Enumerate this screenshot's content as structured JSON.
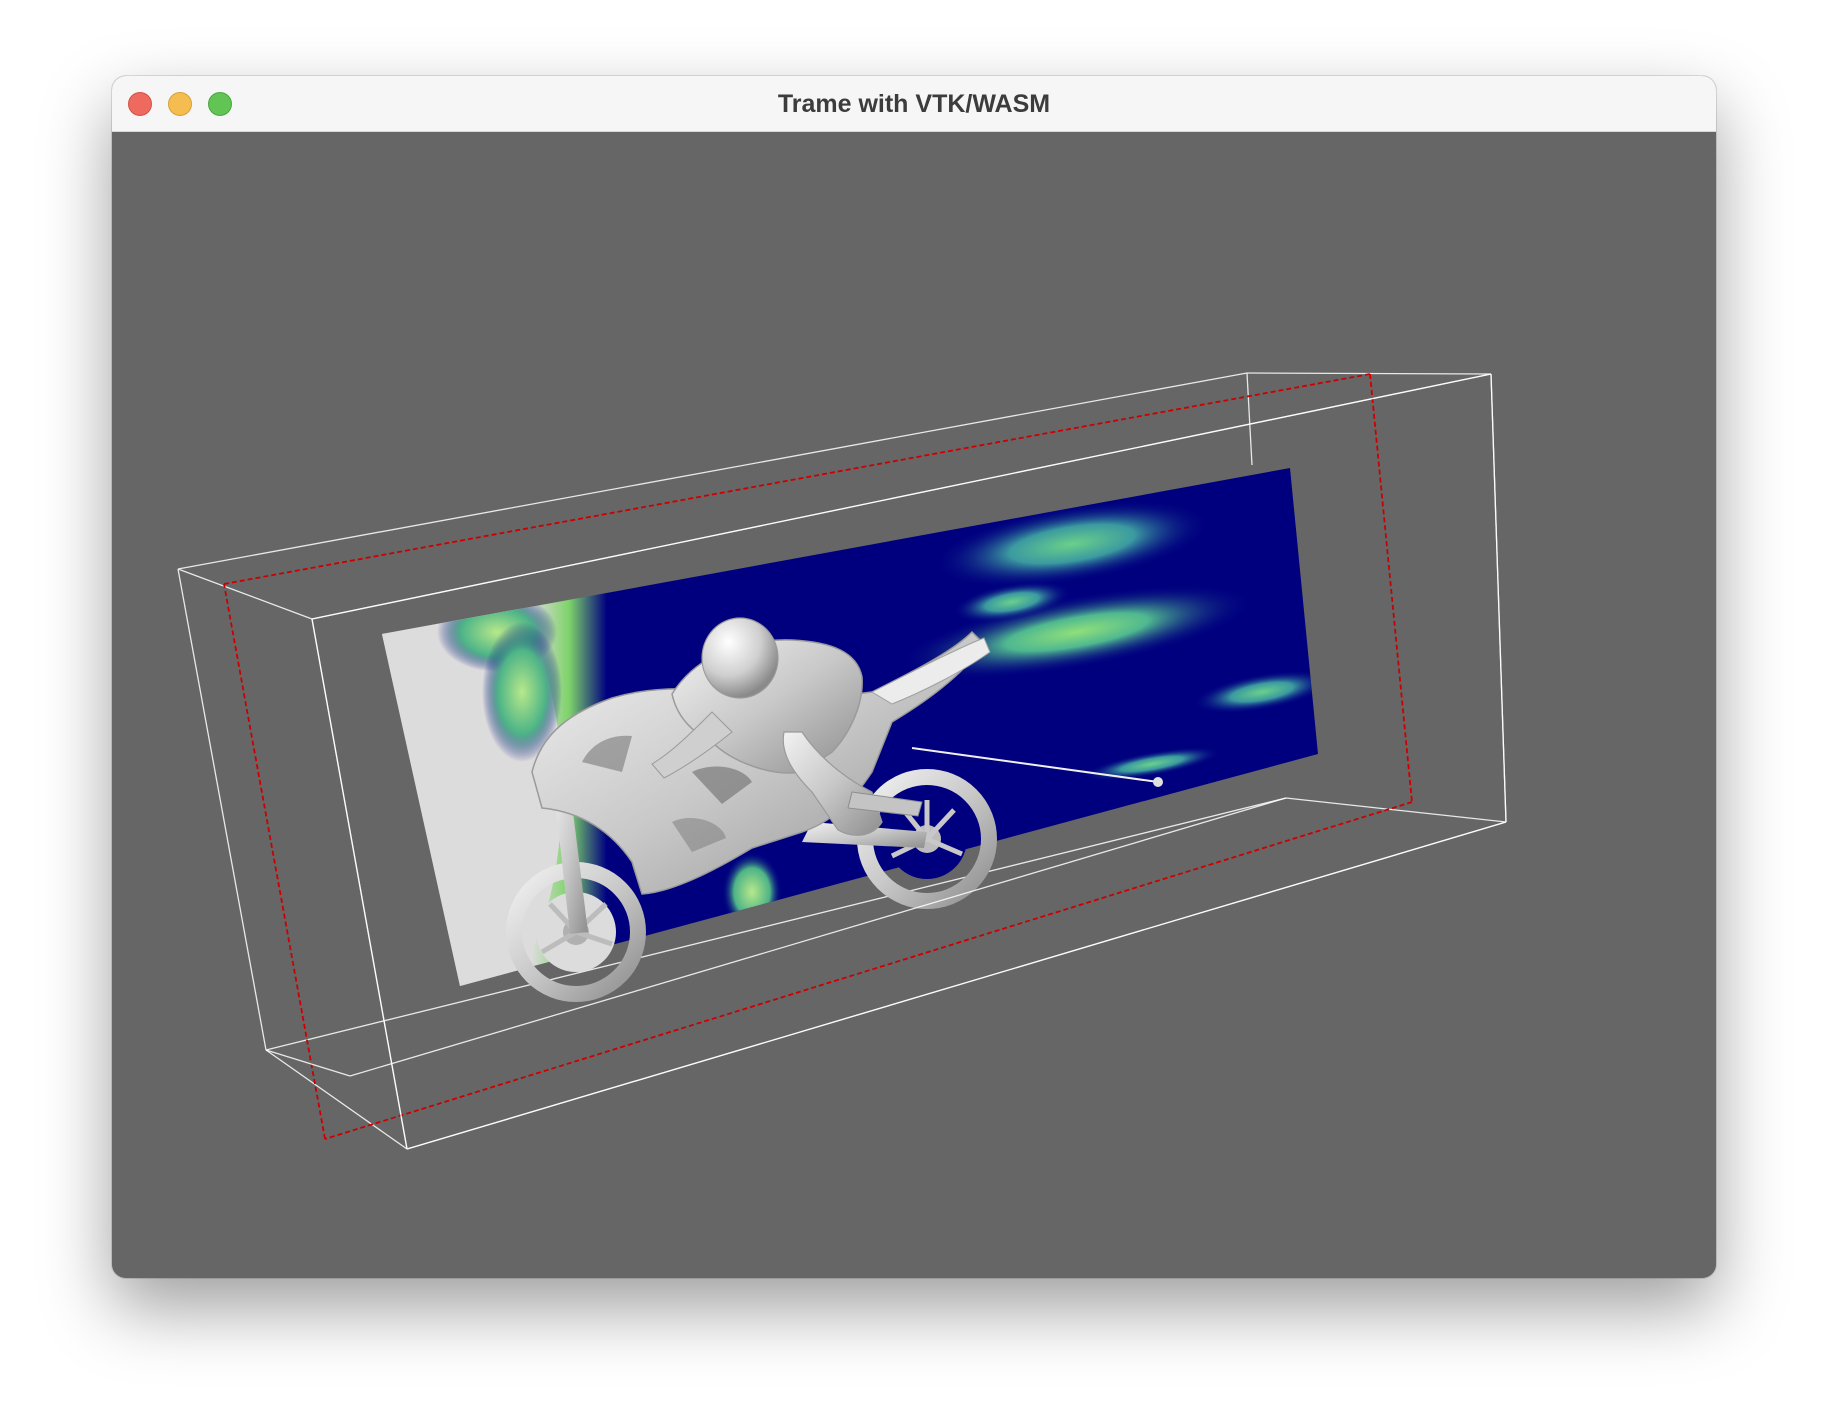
{
  "window": {
    "title": "Trame with VTK/WASM"
  },
  "traffic_lights": {
    "close_icon": "circle-red",
    "minimize_icon": "circle-yellow",
    "zoom_icon": "circle-green"
  },
  "scene": {
    "background_color": "#666666",
    "outline_color": "#ffffff",
    "plane_widget_color": "#cc0000",
    "slice_colormap": [
      "#00007f",
      "#1f5fa0",
      "#4aa6a0",
      "#7ed36a",
      "#dcdcdc"
    ],
    "model_color": "#d0d0d0"
  }
}
